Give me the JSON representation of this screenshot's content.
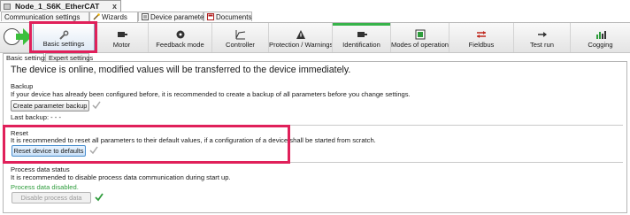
{
  "document_tab": {
    "title": "Node_1_S6K_EtherCAT",
    "close": "x"
  },
  "tabs2": [
    {
      "label": "Communication settings"
    },
    {
      "label": "Wizards"
    },
    {
      "label": "Device parameters"
    },
    {
      "label": "Documents"
    }
  ],
  "ribbon": [
    {
      "label": "Basic settings",
      "icon": "wrench-icon"
    },
    {
      "label": "Motor",
      "icon": "motor-icon"
    },
    {
      "label": "Feedback mode",
      "icon": "feedback-icon"
    },
    {
      "label": "Controller",
      "icon": "controller-icon"
    },
    {
      "label": "Protection / Warnings",
      "icon": "warning-icon"
    },
    {
      "label": "Identification",
      "icon": "identification-icon"
    },
    {
      "label": "Modes of operation",
      "icon": "modes-icon"
    },
    {
      "label": "Fieldbus",
      "icon": "fieldbus-icon"
    },
    {
      "label": "Test run",
      "icon": "test-run-icon"
    },
    {
      "label": "Cogging",
      "icon": "cogging-icon"
    }
  ],
  "subtabs": [
    {
      "label": "Basic settings"
    },
    {
      "label": "Expert settings"
    }
  ],
  "content": {
    "heading": "The device is online, modified  values will be transferred to the device immediately.",
    "backup": {
      "title": "Backup",
      "desc": "If your device has already been configured before, it is recommended to create a backup of all parameters before you change settings.",
      "button": "Create parameter backup",
      "last_backup": "Last backup: - - -"
    },
    "reset": {
      "title": "Reset",
      "desc": "It is recommended to reset all parameters to their default values, if a configuration of a device shall be started from scratch.",
      "button": "Reset device to defaults"
    },
    "process": {
      "title": "Process data status",
      "desc": "It is recommended to disable process data communication during start up.",
      "status": "Process data disabled.",
      "button": "Disable process data"
    }
  },
  "colors": {
    "highlight": "#e0205a",
    "success_green": "#2e9c3c",
    "ribbon_active_bar": "#37b34a"
  }
}
